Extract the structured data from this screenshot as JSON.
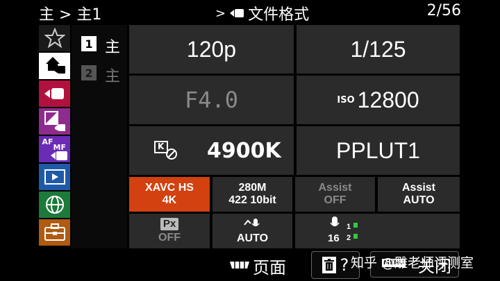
{
  "header": {
    "breadcrumb": "主 > 主1",
    "section_prefix": ">",
    "section_title": "文件格式",
    "page_indicator": "2/56"
  },
  "sidebar": {
    "items": [
      {
        "icon": "star-icon",
        "selected": false
      },
      {
        "icon": "home-icon",
        "selected": true
      },
      {
        "icon": "movie-camera-icon",
        "selected": false
      },
      {
        "icon": "exposure-icon",
        "selected": false
      },
      {
        "icon": "af-mf-icon",
        "label_top": "AF",
        "label_bot": "MF",
        "selected": false
      },
      {
        "icon": "playback-icon",
        "selected": false
      },
      {
        "icon": "globe-icon",
        "selected": false
      },
      {
        "icon": "toolbox-icon",
        "selected": false
      }
    ]
  },
  "sublist": {
    "items": [
      {
        "num": "1",
        "label": "主",
        "active": true
      },
      {
        "num": "2",
        "label": "主",
        "active": false
      }
    ]
  },
  "grid": {
    "frame_rate": "120p",
    "shutter": "1/125",
    "aperture": "F4.0",
    "iso_label": "ISO",
    "iso_value": "12800",
    "wb_icon_letter": "K",
    "white_balance": "4900K",
    "picture_profile": "PPLUT1",
    "format_line1": "XAVC HS",
    "format_line2": "4K",
    "bitrate_line1": "280M",
    "bitrate_line2": "422 10bit",
    "assist1_line1": "Assist",
    "assist1_line2": "OFF",
    "assist2_line1": "Assist",
    "assist2_line2": "AUTO",
    "px_badge": "Px",
    "px_value": "OFF",
    "audio_mode": "AUTO",
    "mic_level": "16",
    "ch1": "1",
    "ch2": "2"
  },
  "footer": {
    "page_label": "页面",
    "delete_label": "?",
    "menu_label": "关闭",
    "menu_badge": "MENU"
  },
  "watermark": "知乎 @雕老师评测室",
  "colors": {
    "accent_orange": "#d2410f",
    "cell_bg": "#2b2b2b",
    "home_bg": "#ffffff",
    "sidebar_movie": "#b0123d",
    "sidebar_exposure": "#8e2b8e",
    "sidebar_af": "#6a2bb5",
    "sidebar_play": "#1f5aa8",
    "sidebar_globe": "#1c7a3a",
    "sidebar_tool": "#b05a12"
  }
}
